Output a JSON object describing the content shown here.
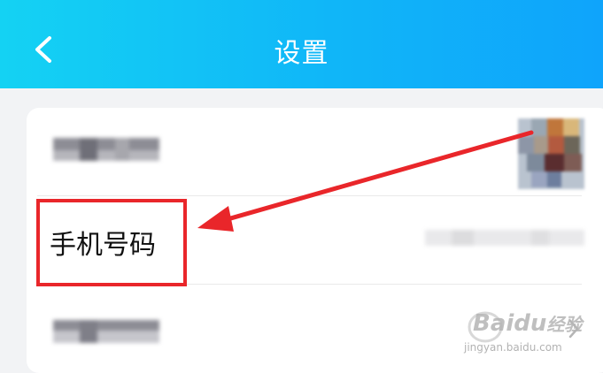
{
  "header": {
    "title": "设置",
    "back_icon": "chevron-left-icon"
  },
  "rows": [
    {
      "label": "",
      "type": "avatar"
    },
    {
      "label": "手机号码",
      "type": "phone"
    },
    {
      "label": "",
      "type": "link",
      "icon": "chevron-right-icon"
    }
  ],
  "watermark": {
    "brand": "Baidu",
    "brand_cn": "经验",
    "url": "jingyan.baidu.com"
  },
  "colors": {
    "header_start": "#14d2f3",
    "header_end": "#0fa4fb",
    "annotation": "#e9262a"
  }
}
